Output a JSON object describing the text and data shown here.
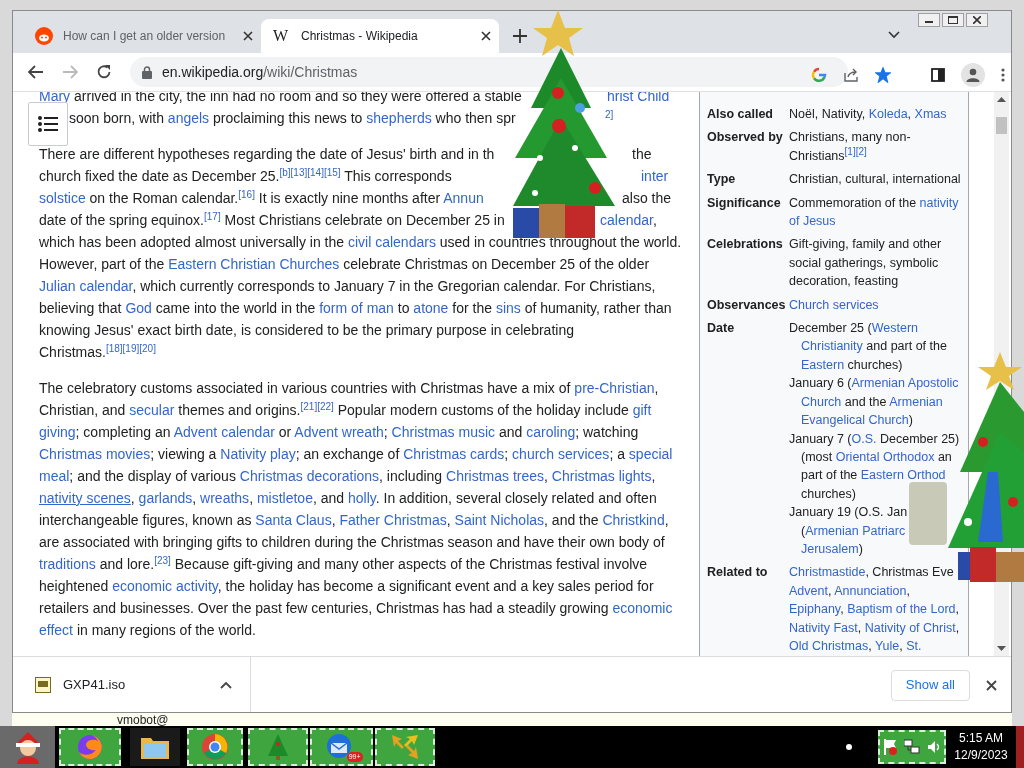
{
  "browser": {
    "tabs": [
      {
        "title": "How can I get an older version",
        "kind": "face",
        "selected": false
      },
      {
        "title": "Christmas - Wikipedia",
        "kind": "letter",
        "letter": "W",
        "selected": true
      }
    ],
    "address": {
      "host": "en.wikipedia.org",
      "path": "/wiki/Christmas"
    },
    "bookmarked": true
  },
  "article": {
    "paragraphs": [
      {
        "lines": [
          {
            "segments": [
              {
                "text": "Mary",
                "kind": "link"
              },
              {
                "text": " arrived in the city, the inn had no room and so they were offered a stable",
                "kind": "text"
              }
            ],
            "after_tree": [
              {
                "text": "hrist Child",
                "kind": "link"
              }
            ]
          },
          {
            "segments": [
              {
                "text": "soon born, with ",
                "kind": "text"
              },
              {
                "text": "angels",
                "kind": "link"
              },
              {
                "text": " proclaiming this news to ",
                "kind": "text"
              },
              {
                "text": "shepherds",
                "kind": "link"
              },
              {
                "text": " who then spr",
                "kind": "text"
              }
            ],
            "after_tree": [
              {
                "text": "2]",
                "kind": "ref"
              }
            ]
          }
        ]
      },
      {
        "lines": [
          {
            "segments": [
              {
                "text": "There are different hypotheses regarding the date of Jesus' birth and in th",
                "kind": "text"
              }
            ],
            "after_tree": [
              {
                "text": "the",
                "kind": "text"
              }
            ]
          },
          {
            "segments": [
              {
                "text": "church fixed the date as December 25.",
                "kind": "text"
              },
              {
                "text": "[b][13][14][15]",
                "kind": "ref"
              },
              {
                "text": " This corresponds ",
                "kind": "text"
              }
            ],
            "after_tree": [
              {
                "text": "inter",
                "kind": "link"
              }
            ]
          },
          {
            "segments": [
              {
                "text": "solstice",
                "kind": "link"
              },
              {
                "text": " on the Roman calendar.",
                "kind": "text"
              },
              {
                "text": "[16]",
                "kind": "ref"
              },
              {
                "text": " It is exactly nine months after ",
                "kind": "text"
              },
              {
                "text": "Annun",
                "kind": "link"
              }
            ],
            "after_tree": [
              {
                "text": "also the",
                "kind": "text"
              }
            ]
          },
          {
            "segments": [
              {
                "text": "date of the spring equinox.",
                "kind": "text"
              },
              {
                "text": "[17]",
                "kind": "ref"
              },
              {
                "text": " Most Christians celebrate on December 25 in",
                "kind": "text"
              }
            ],
            "after_tree": [
              {
                "text": "calendar",
                "kind": "link"
              },
              {
                "text": ",",
                "kind": "text"
              }
            ]
          },
          {
            "segments": [
              {
                "text": "which has been adopted almost universally in the ",
                "kind": "text"
              },
              {
                "text": "civil calendars",
                "kind": "link"
              },
              {
                "text": " used in countries throughout the world.",
                "kind": "text"
              }
            ]
          },
          {
            "segments": [
              {
                "text": "However, part of the ",
                "kind": "text"
              },
              {
                "text": "Eastern Christian Churches",
                "kind": "link"
              },
              {
                "text": " celebrate Christmas on December 25 of the older",
                "kind": "text"
              }
            ]
          },
          {
            "segments": [
              {
                "text": "Julian calendar",
                "kind": "link"
              },
              {
                "text": ", which currently corresponds to January 7 in the Gregorian calendar. For Christians,",
                "kind": "text"
              }
            ]
          },
          {
            "segments": [
              {
                "text": "believing that ",
                "kind": "text"
              },
              {
                "text": "God",
                "kind": "link"
              },
              {
                "text": " came into the world in the ",
                "kind": "text"
              },
              {
                "text": "form of man",
                "kind": "link"
              },
              {
                "text": " to ",
                "kind": "text"
              },
              {
                "text": "atone",
                "kind": "link"
              },
              {
                "text": " for the ",
                "kind": "text"
              },
              {
                "text": "sins",
                "kind": "link"
              },
              {
                "text": " of humanity, rather than",
                "kind": "text"
              }
            ]
          },
          {
            "segments": [
              {
                "text": "knowing Jesus' exact birth date, is considered to be the primary purpose in celebrating",
                "kind": "text"
              }
            ]
          },
          {
            "segments": [
              {
                "text": "Christmas.",
                "kind": "text"
              },
              {
                "text": "[18][19][20]",
                "kind": "ref"
              }
            ]
          }
        ]
      },
      {
        "lines": [
          {
            "segments": [
              {
                "text": "The celebratory customs associated in various countries with Christmas have a mix of ",
                "kind": "text"
              },
              {
                "text": "pre-Christian",
                "kind": "link"
              },
              {
                "text": ",",
                "kind": "text"
              }
            ]
          },
          {
            "segments": [
              {
                "text": "Christian, and ",
                "kind": "text"
              },
              {
                "text": "secular",
                "kind": "link"
              },
              {
                "text": " themes and origins.",
                "kind": "text"
              },
              {
                "text": "[21][22]",
                "kind": "ref"
              },
              {
                "text": " Popular modern customs of the holiday include ",
                "kind": "text"
              },
              {
                "text": "gift",
                "kind": "link"
              }
            ]
          },
          {
            "segments": [
              {
                "text": "giving",
                "kind": "link"
              },
              {
                "text": "; completing an ",
                "kind": "text"
              },
              {
                "text": "Advent calendar",
                "kind": "link"
              },
              {
                "text": " or ",
                "kind": "text"
              },
              {
                "text": "Advent wreath",
                "kind": "link"
              },
              {
                "text": "; ",
                "kind": "text"
              },
              {
                "text": "Christmas music",
                "kind": "link"
              },
              {
                "text": " and ",
                "kind": "text"
              },
              {
                "text": "caroling",
                "kind": "link"
              },
              {
                "text": "; watching",
                "kind": "text"
              }
            ]
          },
          {
            "segments": [
              {
                "text": "Christmas movies",
                "kind": "link"
              },
              {
                "text": "; viewing a ",
                "kind": "text"
              },
              {
                "text": "Nativity play",
                "kind": "link"
              },
              {
                "text": "; an exchange of ",
                "kind": "text"
              },
              {
                "text": "Christmas cards",
                "kind": "link"
              },
              {
                "text": "; ",
                "kind": "text"
              },
              {
                "text": "church services",
                "kind": "link"
              },
              {
                "text": "; a ",
                "kind": "text"
              },
              {
                "text": "special",
                "kind": "link"
              }
            ]
          },
          {
            "segments": [
              {
                "text": "meal",
                "kind": "link"
              },
              {
                "text": "; and the display of various ",
                "kind": "text"
              },
              {
                "text": "Christmas decorations",
                "kind": "link"
              },
              {
                "text": ", including ",
                "kind": "text"
              },
              {
                "text": "Christmas trees",
                "kind": "link"
              },
              {
                "text": ", ",
                "kind": "text"
              },
              {
                "text": "Christmas lights",
                "kind": "link"
              },
              {
                "text": ",",
                "kind": "text"
              }
            ]
          },
          {
            "segments": [
              {
                "text": "nativity scenes",
                "kind": "hover_link"
              },
              {
                "text": ", ",
                "kind": "text"
              },
              {
                "text": "garlands",
                "kind": "link"
              },
              {
                "text": ", ",
                "kind": "text"
              },
              {
                "text": "wreaths",
                "kind": "link"
              },
              {
                "text": ", ",
                "kind": "text"
              },
              {
                "text": "mistletoe",
                "kind": "link"
              },
              {
                "text": ", and ",
                "kind": "text"
              },
              {
                "text": "holly",
                "kind": "link"
              },
              {
                "text": ". In addition, several closely related and often",
                "kind": "text"
              }
            ]
          },
          {
            "segments": [
              {
                "text": "interchangeable figures, known as ",
                "kind": "text"
              },
              {
                "text": "Santa Claus",
                "kind": "link"
              },
              {
                "text": ", ",
                "kind": "text"
              },
              {
                "text": "Father Christmas",
                "kind": "link"
              },
              {
                "text": ", ",
                "kind": "text"
              },
              {
                "text": "Saint Nicholas",
                "kind": "link"
              },
              {
                "text": ", and the ",
                "kind": "text"
              },
              {
                "text": "Christkind",
                "kind": "link"
              },
              {
                "text": ",",
                "kind": "text"
              }
            ]
          },
          {
            "segments": [
              {
                "text": "are associated with bringing gifts to children during the Christmas season and have their own body of",
                "kind": "text"
              }
            ]
          },
          {
            "segments": [
              {
                "text": "traditions",
                "kind": "link"
              },
              {
                "text": " and lore.",
                "kind": "text"
              },
              {
                "text": "[23]",
                "kind": "ref"
              },
              {
                "text": " Because gift-giving and many other aspects of the Christmas festival involve",
                "kind": "text"
              }
            ]
          },
          {
            "segments": [
              {
                "text": "heightened ",
                "kind": "text"
              },
              {
                "text": "economic activity",
                "kind": "link"
              },
              {
                "text": ", the holiday has become a significant event and a key sales period for",
                "kind": "text"
              }
            ]
          },
          {
            "segments": [
              {
                "text": "retailers and businesses. Over the past few centuries, Christmas has had a steadily growing ",
                "kind": "text"
              },
              {
                "text": "economic",
                "kind": "link"
              }
            ]
          },
          {
            "segments": [
              {
                "text": "effect",
                "kind": "link"
              },
              {
                "text": " in many regions of the world.",
                "kind": "text"
              }
            ]
          }
        ]
      }
    ]
  },
  "infobox": {
    "rows": [
      {
        "label": "Also called",
        "entries": [
          [
            [
              {
                "text": "Noël, Nativity, ",
                "kind": "text"
              },
              {
                "text": "Koleda",
                "kind": "link"
              },
              {
                "text": ", ",
                "kind": "text"
              },
              {
                "text": "Xmas",
                "kind": "link"
              }
            ]
          ]
        ]
      },
      {
        "label": "Observed by",
        "entries": [
          [
            [
              {
                "text": "Christians, many non-",
                "kind": "text"
              }
            ],
            [
              {
                "text": "Christians",
                "kind": "text"
              },
              {
                "text": "[1][2]",
                "kind": "ref"
              }
            ]
          ]
        ]
      },
      {
        "label": "Type",
        "entries": [
          [
            [
              {
                "text": "Christian, cultural, international",
                "kind": "text"
              }
            ]
          ]
        ]
      },
      {
        "label": "Significance",
        "entries": [
          [
            [
              {
                "text": "Commemoration of the ",
                "kind": "text"
              },
              {
                "text": "nativity",
                "kind": "link"
              }
            ],
            [
              {
                "text": "of Jesus",
                "kind": "link"
              }
            ]
          ]
        ]
      },
      {
        "label": "Celebrations",
        "entries": [
          [
            [
              {
                "text": "Gift-giving, family and other",
                "kind": "text"
              }
            ],
            [
              {
                "text": "social gatherings, symbolic",
                "kind": "text"
              }
            ],
            [
              {
                "text": "decoration, feasting",
                "kind": "text"
              }
            ]
          ]
        ]
      },
      {
        "label": "Observances",
        "entries": [
          [
            [
              {
                "text": "Church services",
                "kind": "link"
              }
            ]
          ]
        ]
      },
      {
        "label": "Date",
        "entries": [
          [
            [
              {
                "text": "December 25 (",
                "kind": "text"
              },
              {
                "text": "Western",
                "kind": "link"
              }
            ],
            [
              {
                "text": "Christianity",
                "kind": "link"
              },
              {
                "text": " and part of the",
                "kind": "text"
              }
            ],
            [
              {
                "text": "Eastern",
                "kind": "link"
              },
              {
                "text": " churches)",
                "kind": "text"
              }
            ]
          ],
          [
            [
              {
                "text": "January 6 (",
                "kind": "text"
              },
              {
                "text": "Armenian Apostolic",
                "kind": "link"
              }
            ],
            [
              {
                "text": "Church",
                "kind": "link"
              },
              {
                "text": " and the ",
                "kind": "text"
              },
              {
                "text": "Armenian",
                "kind": "link"
              }
            ],
            [
              {
                "text": "Evangelical Church",
                "kind": "link"
              },
              {
                "text": ")",
                "kind": "text"
              }
            ]
          ],
          [
            [
              {
                "text": "January 7 (",
                "kind": "text"
              },
              {
                "text": "O.S.",
                "kind": "link"
              },
              {
                "text": " December 25)",
                "kind": "text"
              }
            ],
            [
              {
                "text": "(most ",
                "kind": "text"
              },
              {
                "text": "Oriental Orthodox",
                "kind": "link"
              },
              {
                "text": " an",
                "kind": "text"
              }
            ],
            [
              {
                "text": "part of the ",
                "kind": "text"
              },
              {
                "text": "Eastern Orthod",
                "kind": "link"
              }
            ],
            [
              {
                "text": "churches)",
                "kind": "text"
              }
            ]
          ],
          [
            [
              {
                "text": "January 19 (O.S. Jan",
                "kind": "text"
              }
            ],
            [
              {
                "text": "(",
                "kind": "text"
              },
              {
                "text": "Armenian Patriarc",
                "kind": "link"
              }
            ],
            [
              {
                "text": "Jerusalem",
                "kind": "link"
              },
              {
                "text": ")",
                "kind": "text"
              }
            ]
          ]
        ]
      },
      {
        "label": "Related to",
        "entries": [
          [
            [
              {
                "text": "Christmastide",
                "kind": "link"
              },
              {
                "text": ", Christmas Eve",
                "kind": "text"
              }
            ],
            [
              {
                "text": "Advent",
                "kind": "link"
              },
              {
                "text": ", ",
                "kind": "text"
              },
              {
                "text": "Annunciation",
                "kind": "link"
              },
              {
                "text": ",",
                "kind": "text"
              }
            ],
            [
              {
                "text": "Epiphany",
                "kind": "link"
              },
              {
                "text": ", ",
                "kind": "text"
              },
              {
                "text": "Baptism of the Lord",
                "kind": "link"
              },
              {
                "text": ",",
                "kind": "text"
              }
            ],
            [
              {
                "text": "Nativity Fast",
                "kind": "link"
              },
              {
                "text": ", ",
                "kind": "text"
              },
              {
                "text": "Nativity of Christ",
                "kind": "link"
              },
              {
                "text": ",",
                "kind": "text"
              }
            ],
            [
              {
                "text": "Old Christmas",
                "kind": "link"
              },
              {
                "text": ", ",
                "kind": "text"
              },
              {
                "text": "Yule",
                "kind": "link"
              },
              {
                "text": ", ",
                "kind": "text"
              },
              {
                "text": "St.",
                "kind": "link"
              }
            ]
          ]
        ]
      }
    ]
  },
  "download": {
    "file": "GXP41.iso",
    "button": "Show all"
  },
  "behind_window_text": "vmobot@",
  "taskbar": {
    "items": [
      {
        "kind": "fox"
      },
      {
        "kind": "folder"
      },
      {
        "kind": "ring"
      },
      {
        "kind": "tree"
      },
      {
        "kind": "mail",
        "badge": "99+"
      },
      {
        "kind": "arrows"
      }
    ],
    "time": "5:15 AM",
    "date": "12/9/2023"
  }
}
